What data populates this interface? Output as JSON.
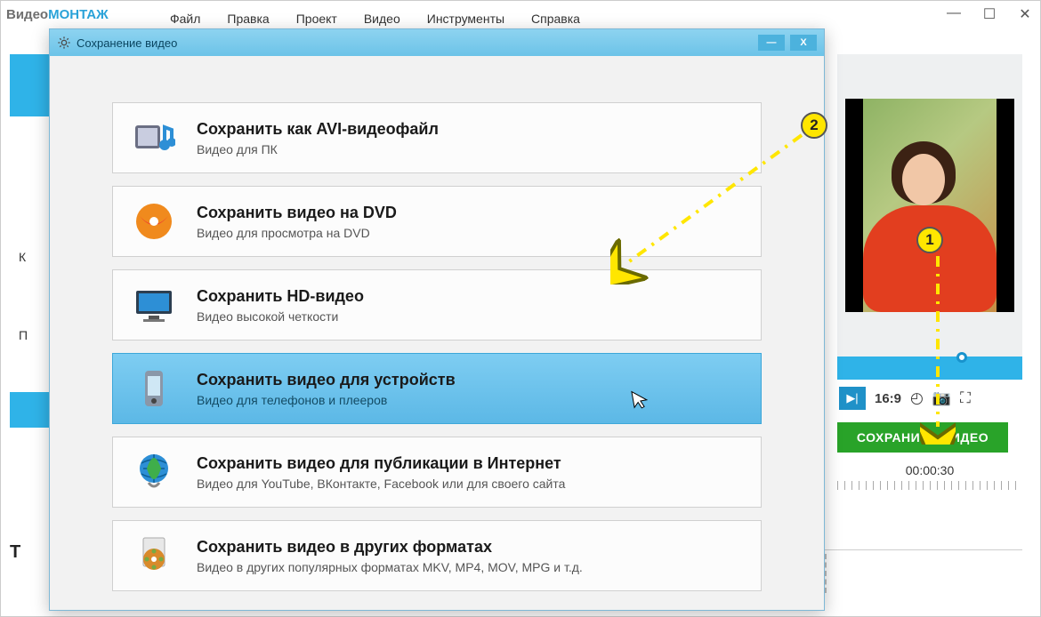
{
  "app": {
    "logo_part1": "Видео",
    "logo_part2": "МОНТАЖ"
  },
  "menu": [
    "Файл",
    "Правка",
    "Проект",
    "Видео",
    "Инструменты",
    "Справка"
  ],
  "preview": {
    "aspect": "16:9",
    "save_button": "СОХРАНИТЬ ВИДЕО",
    "timestamp": "00:00:30"
  },
  "left_labels": {
    "k": "К",
    "p": "П"
  },
  "timeline_marker": "Т",
  "dialog": {
    "title": "Сохранение видео",
    "options": [
      {
        "title": "Сохранить как AVI-видеофайл",
        "sub": "Видео для ПК"
      },
      {
        "title": "Сохранить видео на DVD",
        "sub": "Видео для просмотра на DVD"
      },
      {
        "title": "Сохранить HD-видео",
        "sub": "Видео высокой четкости"
      },
      {
        "title": "Сохранить видео для устройств",
        "sub": "Видео для телефонов и плееров"
      },
      {
        "title": "Сохранить видео для публикации в Интернет",
        "sub": "Видео для YouTube, ВКонтакте, Facebook или для своего сайта"
      },
      {
        "title": "Сохранить видео в других форматах",
        "sub": "Видео в других популярных форматах MKV, MP4, MOV, MPG и т.д."
      }
    ]
  },
  "annotations": {
    "badge1": "1",
    "badge2": "2"
  }
}
